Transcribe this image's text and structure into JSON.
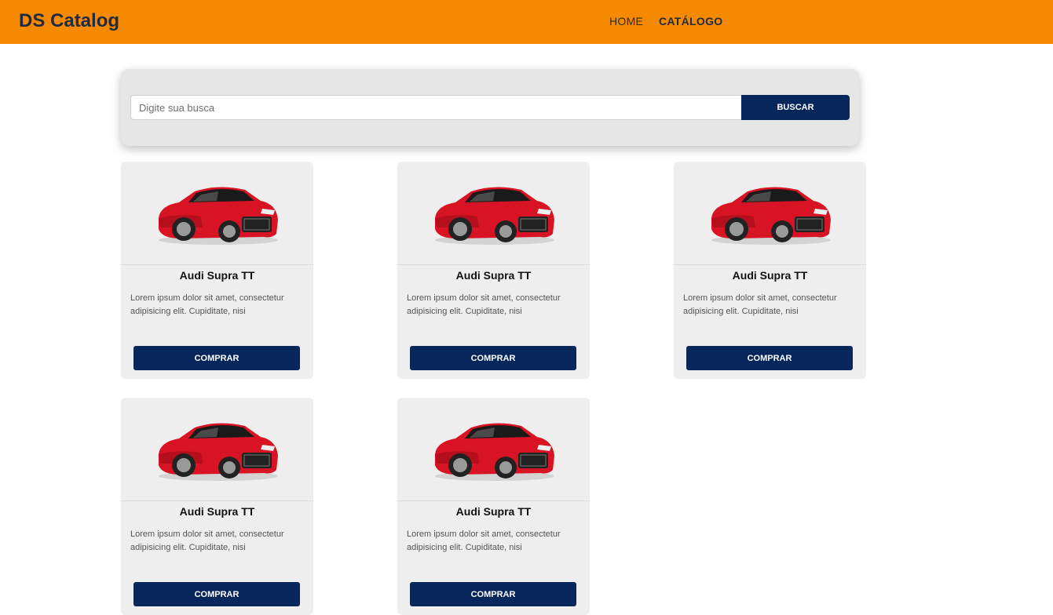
{
  "navbar": {
    "brand": "DS Catalog",
    "links": [
      {
        "label": "HOME",
        "active": false
      },
      {
        "label": "CATÁLOGO",
        "active": true
      }
    ],
    "background": "#f58a00"
  },
  "search": {
    "placeholder": "Digite sua busca",
    "value": "",
    "button_label": "BUSCAR"
  },
  "products": [
    {
      "name": "Audi Supra TT",
      "description": "Lorem ipsum dolor sit amet, consectetur adipisicing elit. Cupiditate, nisi",
      "button_label": "COMPRAR",
      "image": "red-sports-car"
    },
    {
      "name": "Audi Supra TT",
      "description": "Lorem ipsum dolor sit amet, consectetur adipisicing elit. Cupiditate, nisi",
      "button_label": "COMPRAR",
      "image": "red-sports-car"
    },
    {
      "name": "Audi Supra TT",
      "description": "Lorem ipsum dolor sit amet, consectetur adipisicing elit. Cupiditate, nisi",
      "button_label": "COMPRAR",
      "image": "red-sports-car"
    },
    {
      "name": "Audi Supra TT",
      "description": "Lorem ipsum dolor sit amet, consectetur adipisicing elit. Cupiditate, nisi",
      "button_label": "COMPRAR",
      "image": "red-sports-car"
    },
    {
      "name": "Audi Supra TT",
      "description": "Lorem ipsum dolor sit amet, consectetur adipisicing elit. Cupiditate, nisi",
      "button_label": "COMPRAR",
      "image": "red-sports-car"
    }
  ],
  "colors": {
    "accent": "#f58a00",
    "primary_button": "#06265c",
    "card_background": "#eeeeee"
  }
}
